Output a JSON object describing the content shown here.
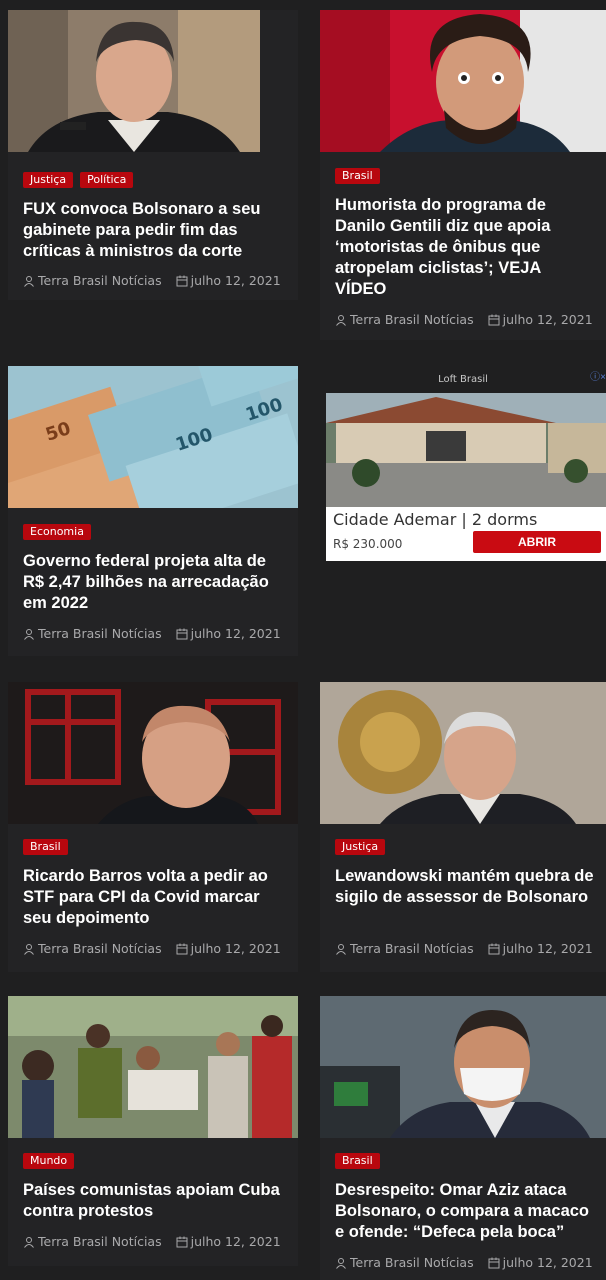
{
  "articles": [
    {
      "tags": [
        "Justiça",
        "Política"
      ],
      "title": "FUX convoca Bolsonaro a seu gabinete para pedir fim das críticas à ministros da corte",
      "author": "Terra Brasil Notícias",
      "date": "julho 12, 2021",
      "image": "man-in-robe-portrait"
    },
    {
      "tags": [
        "Brasil"
      ],
      "title": "Humorista do programa de Danilo Gentili diz que apoia ‘motoristas de ônibus que atropelam ciclistas’; VEJA VÍDEO",
      "author": "Terra Brasil Notícias",
      "date": "julho 12, 2021",
      "image": "bearded-man-surprised"
    },
    {
      "tags": [
        "Economia"
      ],
      "title": "Governo federal projeta alta de R$ 2,47 bilhões na arrecadação em 2022",
      "author": "Terra Brasil Notícias",
      "date": "julho 12, 2021",
      "image": "real-banknotes"
    },
    {
      "tags": [
        "Brasil"
      ],
      "title": "Ricardo Barros volta a pedir ao STF para CPI da Covid marcar seu depoimento",
      "author": "Terra Brasil Notícias",
      "date": "julho 12, 2021",
      "image": "bald-man-red-background"
    },
    {
      "tags": [
        "Justiça"
      ],
      "title": "Lewandowski mantém quebra de sigilo de assessor de Bolsonaro",
      "author": "Terra Brasil Notícias",
      "date": "julho 12, 2021",
      "image": "judge-with-coat-of-arms"
    },
    {
      "tags": [
        "Mundo"
      ],
      "title": "Países comunistas apoiam Cuba contra protestos",
      "author": "Terra Brasil Notícias",
      "date": "julho 12, 2021",
      "image": "street-protest-crowd"
    },
    {
      "tags": [
        "Brasil"
      ],
      "title": "Desrespeito: Omar Aziz ataca Bolsonaro, o compara a macaco e ofende: “Defeca pela boca”",
      "author": "Terra Brasil Notícias",
      "date": "julho 12, 2021",
      "image": "man-with-face-mask"
    }
  ],
  "ad": {
    "sponsor": "Loft Brasil",
    "headline": "Cidade Ademar | 2 dorms",
    "price": "R$ 230.000",
    "cta": "ABRIR",
    "image": "gated-entrance"
  },
  "icons": {
    "author": "user-icon",
    "date": "calendar-icon",
    "ad_choices": "ad-choices-icon"
  },
  "colors": {
    "background": "#1f1f20",
    "card": "#232325",
    "tag": "#b8070e",
    "text": "#ffffff",
    "meta": "#a9a9ab"
  }
}
